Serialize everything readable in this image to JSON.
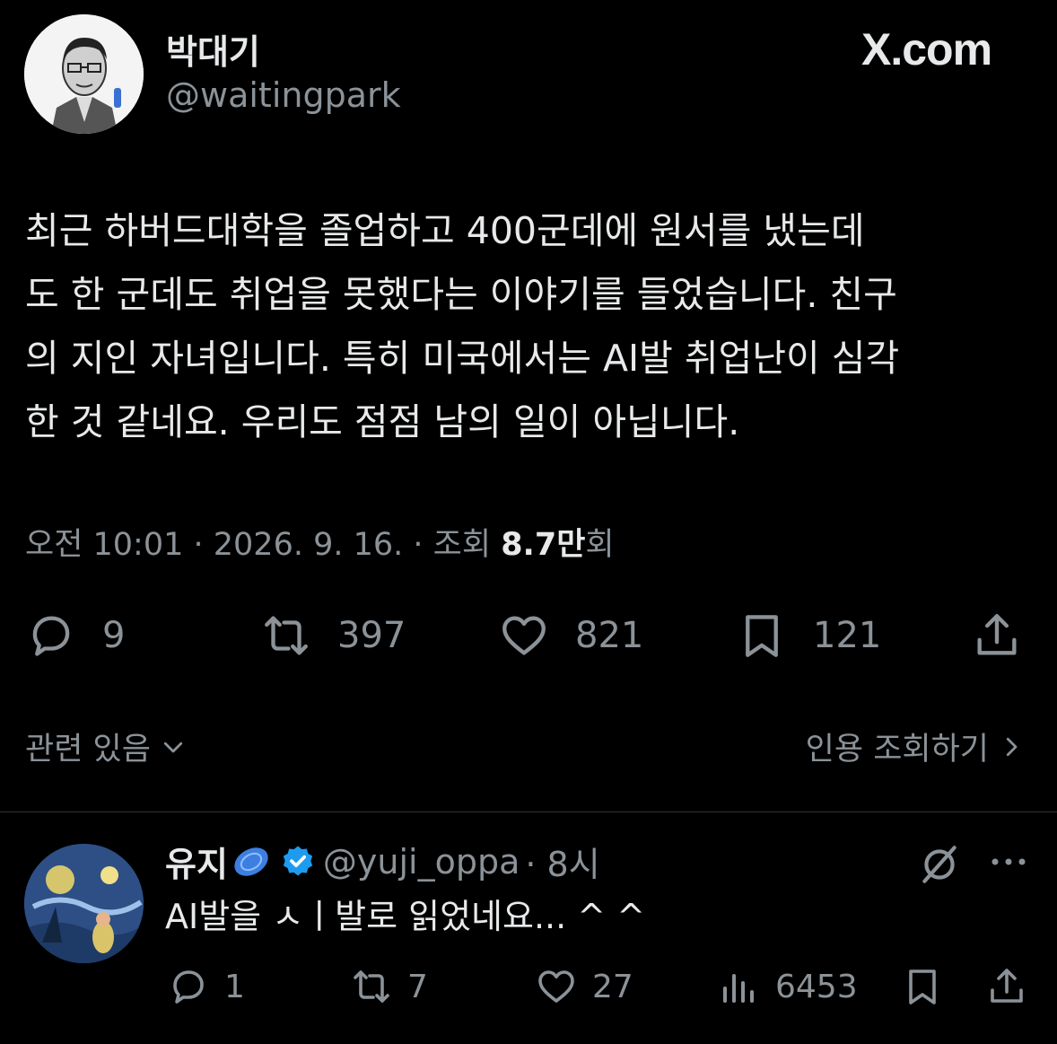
{
  "author": {
    "name": "박대기",
    "handle": "@waitingpark",
    "avatar_icon": "avatar-portrait"
  },
  "site_logo": "X.com",
  "tweet": {
    "lines": [
      "최근 하버드대학을 졸업하고 400군데에 원서를 냈는데",
      "도 한 군데도 취업을 못했다는 이야기를 들었습니다. 친구",
      "의 지인 자녀입니다. 특히 미국에서는 AI발 취업난이 심각",
      "한 것 같네요. 우리도 점점 남의 일이 아닙니다."
    ],
    "meta_prefix": "오전 10:01 · 2026. 9. 16. · 조회 ",
    "views": "8.7만",
    "views_suffix": "회"
  },
  "actions": {
    "replies": "9",
    "retweets": "397",
    "likes": "821",
    "bookmarks": "121"
  },
  "related_label": "관련 있음",
  "quotes_label": "인용 조회하기",
  "reply": {
    "name": "유지",
    "handle": "@yuji_oppa",
    "time": "· 8시",
    "text": "AI발을 ㅅㅣ발로 읽었네요... ^ ^",
    "actions": {
      "replies": "1",
      "retweets": "7",
      "likes": "27",
      "views": "6453"
    }
  },
  "colors": {
    "background": "#000000",
    "text": "#e7e9ea",
    "muted": "#8b9298",
    "verified": "#1d9bf0"
  }
}
